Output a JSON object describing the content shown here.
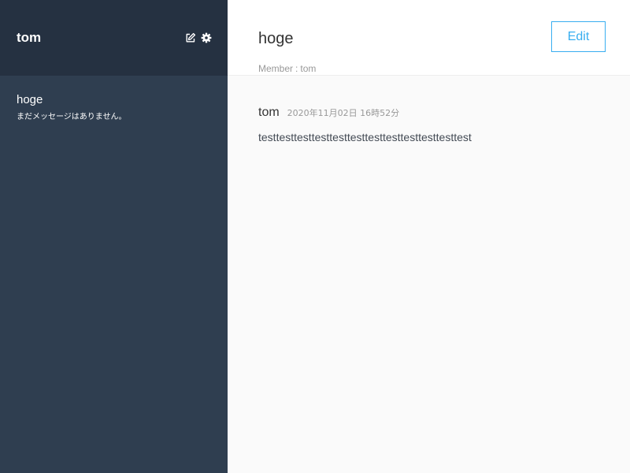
{
  "sidebar": {
    "user_name": "tom",
    "icons": [
      "edit-icon",
      "gear-icon"
    ],
    "groups": [
      {
        "name": "hoge",
        "last_message": "まだメッセージはありません。"
      }
    ]
  },
  "main": {
    "group_title": "hoge",
    "member_label": "Member",
    "member_sep": ":",
    "members": "tom",
    "edit_label": "Edit",
    "messages": [
      {
        "user": "tom",
        "date": "2020年11月02日 16時52分",
        "text": "testtesttesttesttesttesttesttesttesttesttesttest"
      }
    ]
  },
  "colors": {
    "sidebar_header": "#253141",
    "sidebar_body": "#2f3e50",
    "accent": "#38aef0",
    "main_bg": "#fafafa"
  }
}
